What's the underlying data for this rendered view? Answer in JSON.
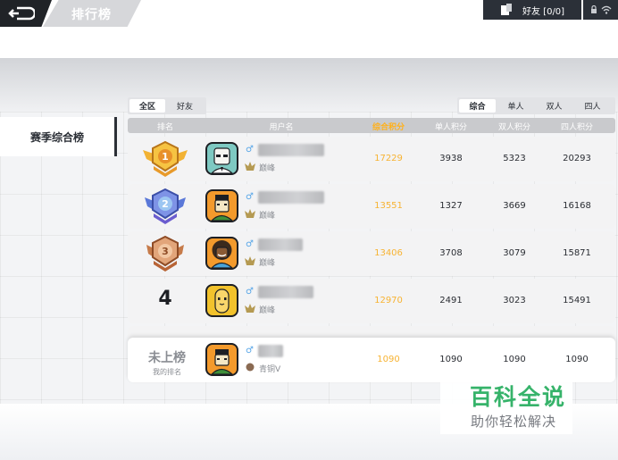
{
  "header": {
    "title": "排行榜",
    "friends_label": "好友 [0/0]"
  },
  "sidebar": {
    "season_tab": "赛季综合榜"
  },
  "scope_tabs": [
    "全区",
    "好友"
  ],
  "mode_tabs": [
    "综合",
    "单人",
    "双人",
    "四人"
  ],
  "columns": {
    "rank": "排名",
    "username": "用户名",
    "total": "综合积分",
    "solo": "单人积分",
    "duo": "双人积分",
    "squad": "四人积分"
  },
  "rows": [
    {
      "rank": "1",
      "gender": "♂",
      "tier": "巅峰",
      "total": "17229",
      "solo": "3938",
      "duo": "5323",
      "squad": "20293"
    },
    {
      "rank": "2",
      "gender": "♂",
      "tier": "巅峰",
      "total": "13551",
      "solo": "1327",
      "duo": "3669",
      "squad": "16168"
    },
    {
      "rank": "3",
      "gender": "♂",
      "tier": "巅峰",
      "total": "13406",
      "solo": "3708",
      "duo": "3079",
      "squad": "15871"
    },
    {
      "rank": "4",
      "gender": "♂",
      "tier": "巅峰",
      "total": "12970",
      "solo": "2491",
      "duo": "3023",
      "squad": "15491"
    }
  ],
  "my_row": {
    "rank_text": "未上榜",
    "rank_label": "我的排名",
    "gender": "♂",
    "tier": "青铜V",
    "total": "1090",
    "solo": "1090",
    "duo": "1090",
    "squad": "1090"
  },
  "watermark": {
    "title": "百科全说",
    "subtitle": "助你轻松解决"
  },
  "colors": {
    "accent_orange": "#ffb11b",
    "dark_bar": "#2b3038",
    "watermark_green": "#36b36a"
  }
}
